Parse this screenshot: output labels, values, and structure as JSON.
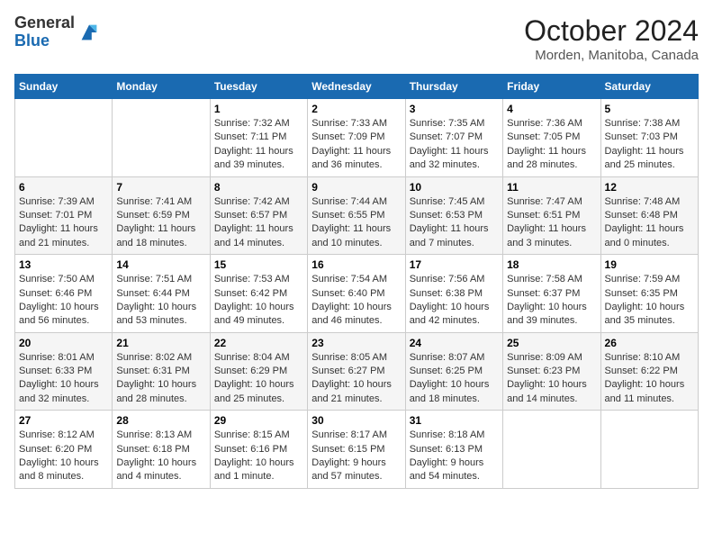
{
  "header": {
    "logo_general": "General",
    "logo_blue": "Blue",
    "month_title": "October 2024",
    "location": "Morden, Manitoba, Canada"
  },
  "calendar": {
    "days_of_week": [
      "Sunday",
      "Monday",
      "Tuesday",
      "Wednesday",
      "Thursday",
      "Friday",
      "Saturday"
    ],
    "weeks": [
      [
        {
          "day": "",
          "info": ""
        },
        {
          "day": "",
          "info": ""
        },
        {
          "day": "1",
          "info": "Sunrise: 7:32 AM\nSunset: 7:11 PM\nDaylight: 11 hours and 39 minutes."
        },
        {
          "day": "2",
          "info": "Sunrise: 7:33 AM\nSunset: 7:09 PM\nDaylight: 11 hours and 36 minutes."
        },
        {
          "day": "3",
          "info": "Sunrise: 7:35 AM\nSunset: 7:07 PM\nDaylight: 11 hours and 32 minutes."
        },
        {
          "day": "4",
          "info": "Sunrise: 7:36 AM\nSunset: 7:05 PM\nDaylight: 11 hours and 28 minutes."
        },
        {
          "day": "5",
          "info": "Sunrise: 7:38 AM\nSunset: 7:03 PM\nDaylight: 11 hours and 25 minutes."
        }
      ],
      [
        {
          "day": "6",
          "info": "Sunrise: 7:39 AM\nSunset: 7:01 PM\nDaylight: 11 hours and 21 minutes."
        },
        {
          "day": "7",
          "info": "Sunrise: 7:41 AM\nSunset: 6:59 PM\nDaylight: 11 hours and 18 minutes."
        },
        {
          "day": "8",
          "info": "Sunrise: 7:42 AM\nSunset: 6:57 PM\nDaylight: 11 hours and 14 minutes."
        },
        {
          "day": "9",
          "info": "Sunrise: 7:44 AM\nSunset: 6:55 PM\nDaylight: 11 hours and 10 minutes."
        },
        {
          "day": "10",
          "info": "Sunrise: 7:45 AM\nSunset: 6:53 PM\nDaylight: 11 hours and 7 minutes."
        },
        {
          "day": "11",
          "info": "Sunrise: 7:47 AM\nSunset: 6:51 PM\nDaylight: 11 hours and 3 minutes."
        },
        {
          "day": "12",
          "info": "Sunrise: 7:48 AM\nSunset: 6:48 PM\nDaylight: 11 hours and 0 minutes."
        }
      ],
      [
        {
          "day": "13",
          "info": "Sunrise: 7:50 AM\nSunset: 6:46 PM\nDaylight: 10 hours and 56 minutes."
        },
        {
          "day": "14",
          "info": "Sunrise: 7:51 AM\nSunset: 6:44 PM\nDaylight: 10 hours and 53 minutes."
        },
        {
          "day": "15",
          "info": "Sunrise: 7:53 AM\nSunset: 6:42 PM\nDaylight: 10 hours and 49 minutes."
        },
        {
          "day": "16",
          "info": "Sunrise: 7:54 AM\nSunset: 6:40 PM\nDaylight: 10 hours and 46 minutes."
        },
        {
          "day": "17",
          "info": "Sunrise: 7:56 AM\nSunset: 6:38 PM\nDaylight: 10 hours and 42 minutes."
        },
        {
          "day": "18",
          "info": "Sunrise: 7:58 AM\nSunset: 6:37 PM\nDaylight: 10 hours and 39 minutes."
        },
        {
          "day": "19",
          "info": "Sunrise: 7:59 AM\nSunset: 6:35 PM\nDaylight: 10 hours and 35 minutes."
        }
      ],
      [
        {
          "day": "20",
          "info": "Sunrise: 8:01 AM\nSunset: 6:33 PM\nDaylight: 10 hours and 32 minutes."
        },
        {
          "day": "21",
          "info": "Sunrise: 8:02 AM\nSunset: 6:31 PM\nDaylight: 10 hours and 28 minutes."
        },
        {
          "day": "22",
          "info": "Sunrise: 8:04 AM\nSunset: 6:29 PM\nDaylight: 10 hours and 25 minutes."
        },
        {
          "day": "23",
          "info": "Sunrise: 8:05 AM\nSunset: 6:27 PM\nDaylight: 10 hours and 21 minutes."
        },
        {
          "day": "24",
          "info": "Sunrise: 8:07 AM\nSunset: 6:25 PM\nDaylight: 10 hours and 18 minutes."
        },
        {
          "day": "25",
          "info": "Sunrise: 8:09 AM\nSunset: 6:23 PM\nDaylight: 10 hours and 14 minutes."
        },
        {
          "day": "26",
          "info": "Sunrise: 8:10 AM\nSunset: 6:22 PM\nDaylight: 10 hours and 11 minutes."
        }
      ],
      [
        {
          "day": "27",
          "info": "Sunrise: 8:12 AM\nSunset: 6:20 PM\nDaylight: 10 hours and 8 minutes."
        },
        {
          "day": "28",
          "info": "Sunrise: 8:13 AM\nSunset: 6:18 PM\nDaylight: 10 hours and 4 minutes."
        },
        {
          "day": "29",
          "info": "Sunrise: 8:15 AM\nSunset: 6:16 PM\nDaylight: 10 hours and 1 minute."
        },
        {
          "day": "30",
          "info": "Sunrise: 8:17 AM\nSunset: 6:15 PM\nDaylight: 9 hours and 57 minutes."
        },
        {
          "day": "31",
          "info": "Sunrise: 8:18 AM\nSunset: 6:13 PM\nDaylight: 9 hours and 54 minutes."
        },
        {
          "day": "",
          "info": ""
        },
        {
          "day": "",
          "info": ""
        }
      ]
    ]
  }
}
